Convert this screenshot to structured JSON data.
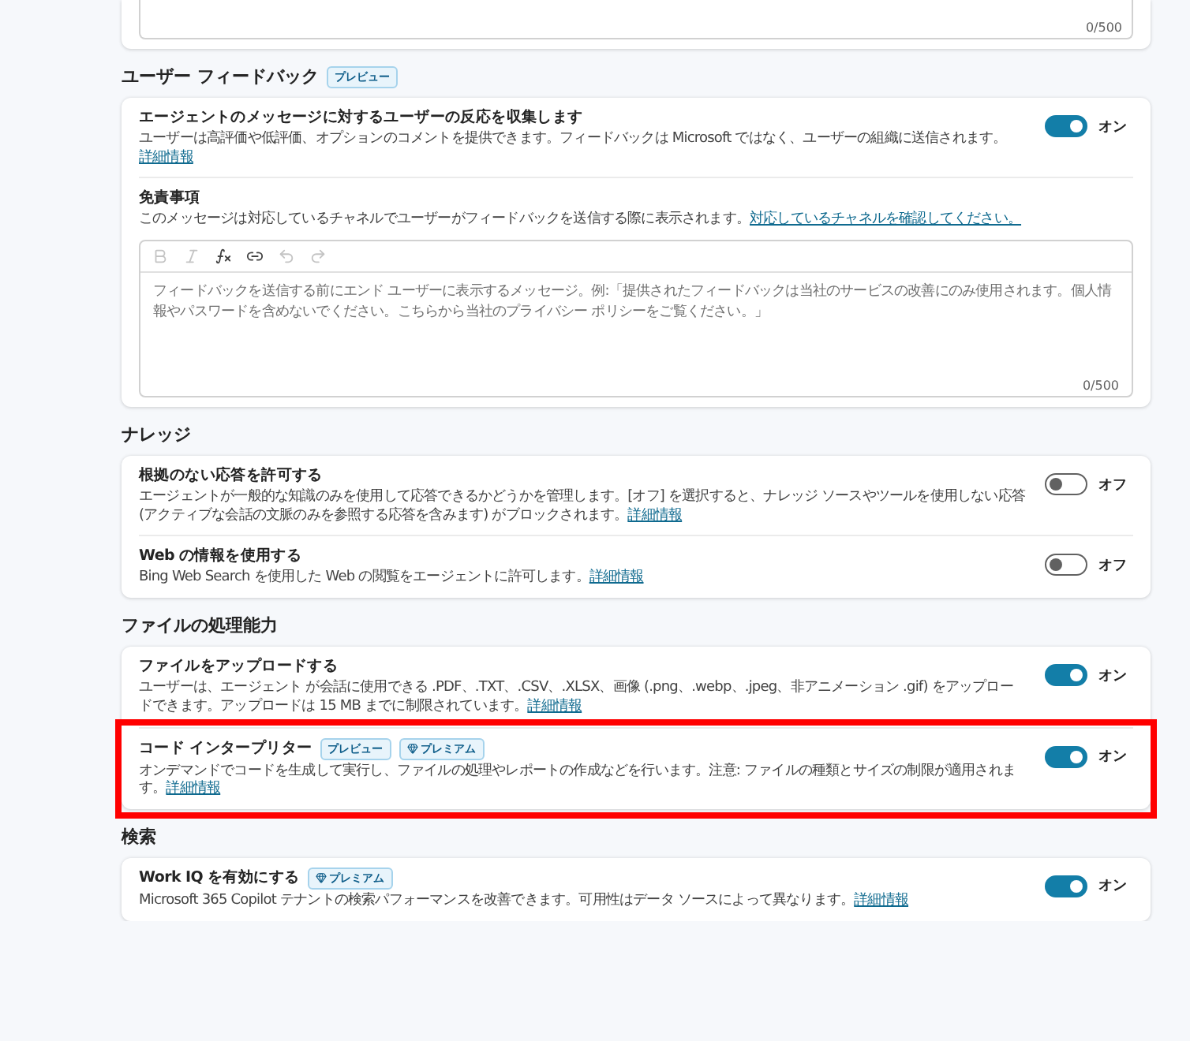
{
  "top_field": {
    "counter": "0/500"
  },
  "sections": [
    {
      "title": "ユーザー フィードバック",
      "badges": [
        {
          "kind": "preview",
          "label": "プレビュー"
        }
      ],
      "items": [
        {
          "kind": "toggle",
          "title": "エージェントのメッセージに対するユーザーの反応を収集します",
          "description": "ユーザーは高評価や低評価、オプションのコメントを提供できます。フィードバックは Microsoft ではなく、ユーザーの組織に送信されます。",
          "link": "詳細情報",
          "on": true,
          "state_label": "オン"
        },
        {
          "kind": "editor",
          "title": "免責事項",
          "description": "このメッセージは対応しているチャネルでユーザーがフィードバックを送信する際に表示されます。",
          "link": "対応しているチャネルを確認してください。",
          "toolbar": [
            {
              "kind": "bold",
              "disabled": true
            },
            {
              "kind": "italic",
              "disabled": true
            },
            {
              "kind": "formula",
              "disabled": false
            },
            {
              "kind": "link",
              "disabled": false
            },
            {
              "kind": "undo",
              "disabled": true
            },
            {
              "kind": "redo",
              "disabled": true
            }
          ],
          "placeholder": "フィードバックを送信する前にエンド ユーザーに表示するメッセージ。例:「提供されたフィードバックは当社のサービスの改善にのみ使用されます。個人情報やパスワードを含めないでください。こちらから当社のプライバシー ポリシーをご覧ください。」",
          "counter": "0/500"
        }
      ]
    },
    {
      "title": "ナレッジ",
      "items": [
        {
          "kind": "toggle",
          "title": "根拠のない応答を許可する",
          "description": "エージェントが一般的な知識のみを使用して応答できるかどうかを管理します。[オフ] を選択すると、ナレッジ ソースやツールを使用しない応答 (アクティブな会話の文脈のみを参照する応答を含みます) がブロックされます。",
          "link": "詳細情報",
          "on": false,
          "state_label": "オフ"
        },
        {
          "kind": "toggle",
          "title": "Web の情報を使用する",
          "description": "Bing Web Search を使用した Web の閲覧をエージェントに許可します。",
          "link": "詳細情報",
          "on": false,
          "state_label": "オフ"
        }
      ]
    },
    {
      "title": "ファイルの処理能力",
      "items": [
        {
          "kind": "toggle",
          "title": "ファイルをアップロードする",
          "description": "ユーザーは、エージェント が会話に使用できる .PDF、.TXT、.CSV、.XLSX、画像 (.png、.webp、.jpeg、非アニメーション .gif) をアップロードできます。アップロードは 15 MB までに制限されています。",
          "link": "詳細情報",
          "on": true,
          "state_label": "オン"
        },
        {
          "kind": "toggle",
          "title": "コード インタープリター",
          "badges": [
            {
              "kind": "preview",
              "label": "プレビュー"
            },
            {
              "kind": "premium",
              "label": "プレミアム"
            }
          ],
          "description": "オンデマンドでコードを生成して実行し、ファイルの処理やレポートの作成などを行います。注意: ファイルの種類とサイズの制限が適用されます。",
          "link": "詳細情報",
          "on": true,
          "state_label": "オン",
          "highlighted": true
        }
      ]
    },
    {
      "title": "検索",
      "items": [
        {
          "kind": "toggle",
          "title": "Work IQ を有効にする",
          "badges": [
            {
              "kind": "premium",
              "label": "プレミアム"
            }
          ],
          "description": "Microsoft 365 Copilot テナントの検索パフォーマンスを改善できます。可用性はデータ ソースによって異なります。",
          "link": "詳細情報",
          "on": true,
          "state_label": "オン"
        }
      ]
    }
  ]
}
